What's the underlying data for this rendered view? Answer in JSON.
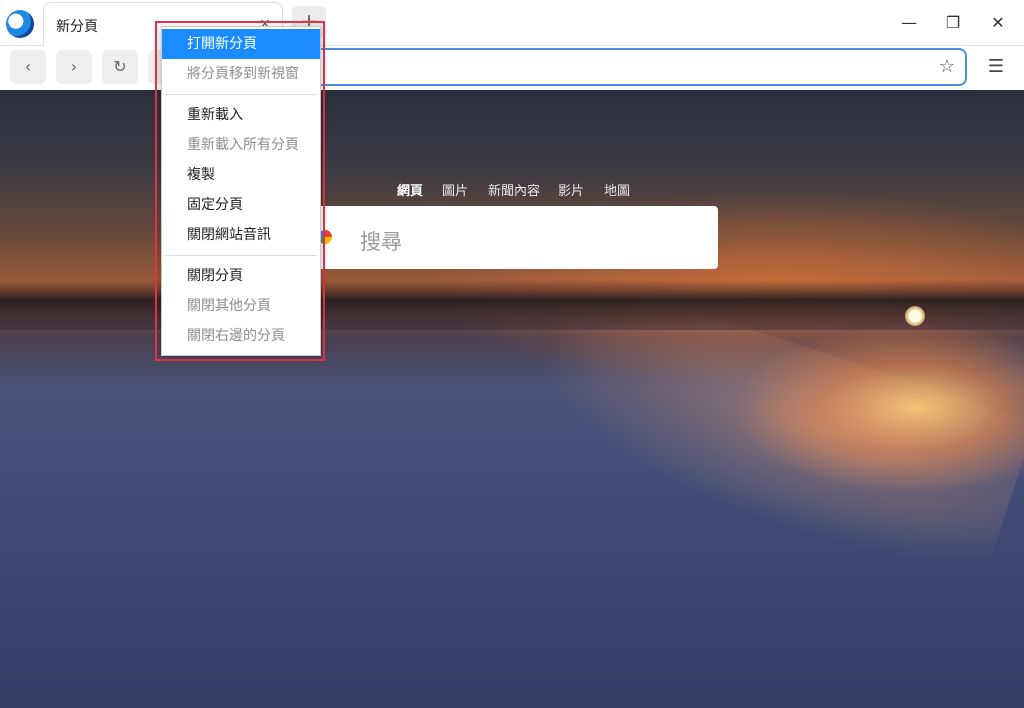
{
  "tab": {
    "title": "新分頁",
    "close_glyph": "×"
  },
  "new_tab_glyph": "+",
  "window": {
    "min_glyph": "—",
    "max_glyph": "❐",
    "close_glyph": "✕"
  },
  "toolbar": {
    "back_glyph": "‹",
    "forward_glyph": "›",
    "reload_glyph": "↻",
    "star_glyph": "☆",
    "menu_glyph": "☰"
  },
  "search": {
    "tabs": [
      "網頁",
      "圖片",
      "新聞內容",
      "影片",
      "地圖"
    ],
    "active_tab": "網頁",
    "placeholder": "搜尋"
  },
  "context_menu": {
    "group1": [
      {
        "label": "打開新分頁",
        "state": "selected"
      },
      {
        "label": "將分頁移到新視窗",
        "state": "disabled"
      }
    ],
    "group2": [
      {
        "label": "重新載入",
        "state": "enabled"
      },
      {
        "label": "重新載入所有分頁",
        "state": "disabled"
      },
      {
        "label": "複製",
        "state": "enabled"
      },
      {
        "label": "固定分頁",
        "state": "enabled"
      },
      {
        "label": "關閉網站音訊",
        "state": "enabled"
      }
    ],
    "group3": [
      {
        "label": "關閉分頁",
        "state": "enabled"
      },
      {
        "label": "關閉其他分頁",
        "state": "disabled"
      },
      {
        "label": "關閉右邊的分頁",
        "state": "disabled"
      }
    ]
  },
  "colors": {
    "menu_selected": "#1a8cff",
    "highlight_border": "#e8334a",
    "omnibox_focus": "#4a90e2"
  }
}
